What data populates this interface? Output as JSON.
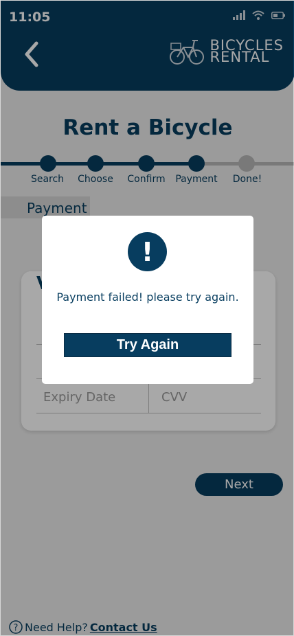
{
  "status": {
    "time": "11:05"
  },
  "brand": {
    "line1": "BICYCLES",
    "line2": "RENTAL"
  },
  "page_title": "Rent a Bicycle",
  "steps": [
    {
      "label": "Search",
      "state": "done"
    },
    {
      "label": "Choose",
      "state": "done"
    },
    {
      "label": "Confirm",
      "state": "done"
    },
    {
      "label": "Payment",
      "state": "current"
    },
    {
      "label": "Done!",
      "state": "pending"
    }
  ],
  "section": {
    "label": "Payment"
  },
  "form": {
    "expiry_placeholder": "Expiry Date",
    "cvv_placeholder": "CVV"
  },
  "next_label": "Next",
  "help": {
    "text": "Need Help?",
    "link": "Contact Us"
  },
  "modal": {
    "icon": "!",
    "message": "Payment failed! please try again.",
    "button": "Try Again"
  },
  "colors": {
    "primary": "#073d5f",
    "inactive": "#b8b8b8",
    "background": "#ececec"
  }
}
